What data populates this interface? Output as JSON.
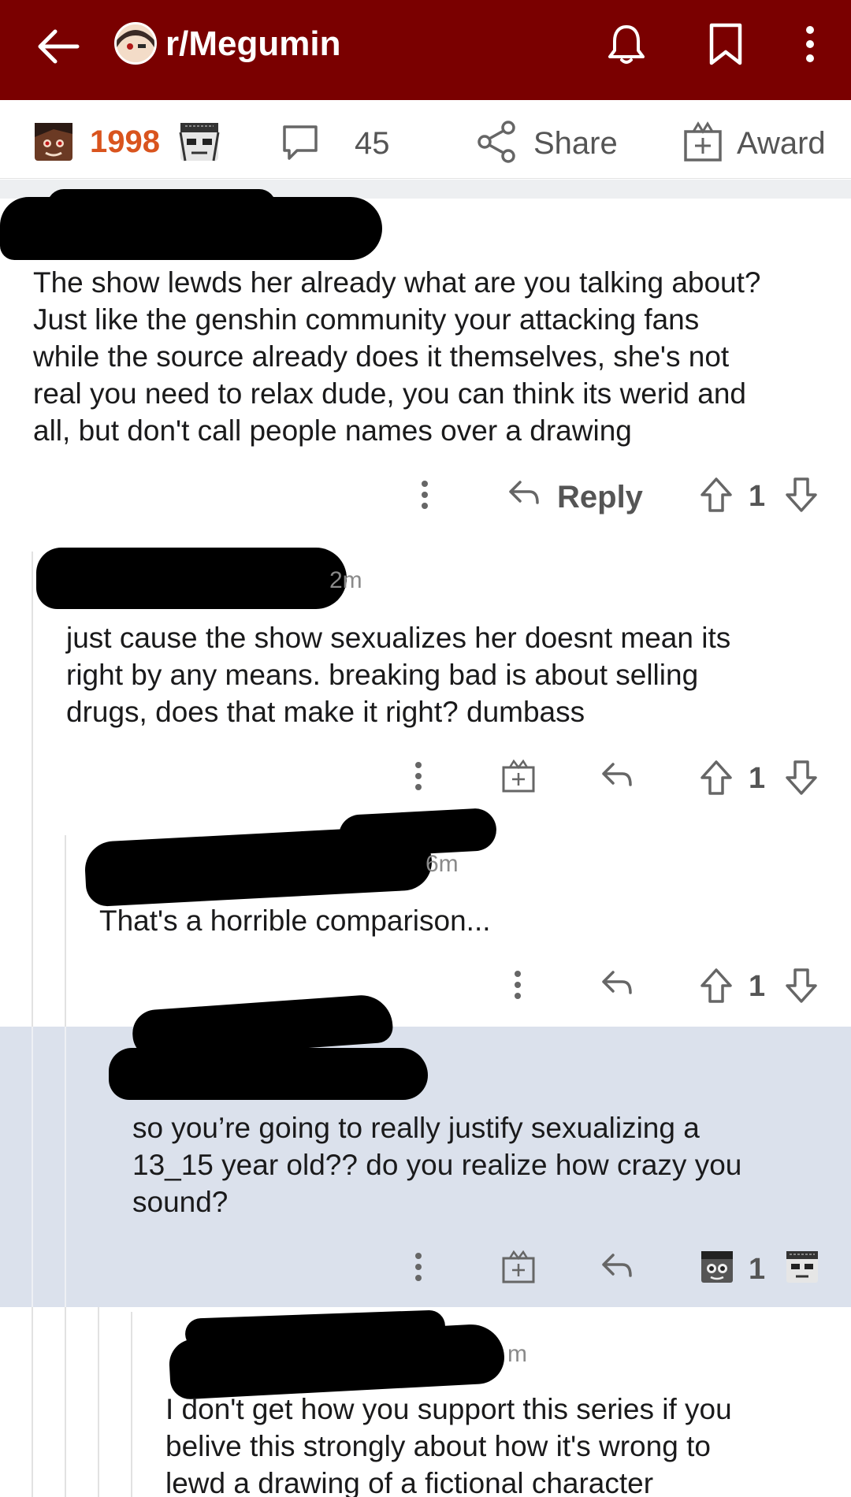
{
  "header": {
    "subreddit": "r/Megumin",
    "back_icon": "arrow-left-icon",
    "bell_icon": "bell-icon",
    "bookmark_icon": "bookmark-icon",
    "more_icon": "more-vertical-icon",
    "bar_color": "#7a0000"
  },
  "post_actions": {
    "score": "1998",
    "comment_count": "45",
    "share_label": "Share",
    "award_label": "Award",
    "score_color": "#d9541e"
  },
  "comments": [
    {
      "time": "",
      "text_lines": [
        "The show lewds her already what are you talking about?",
        "Just like the genshin community your attacking fans",
        "while the source already does it themselves, she's not",
        "real you need to relax dude, you can think its werid and",
        "all, but don't call people names over a drawing"
      ],
      "reply_label": "Reply",
      "votes": "1"
    },
    {
      "time": "2m",
      "text_lines": [
        "just cause the show sexualizes her doesnt mean its",
        "right by any means. breaking bad is about selling",
        "drugs, does that make it right? dumbass"
      ],
      "votes": "1"
    },
    {
      "time": "6m",
      "text_lines": [
        "That's a horrible comparison..."
      ],
      "votes": "1"
    },
    {
      "time": "",
      "text_lines": [
        "so you’re going to really justify sexualizing a",
        "13_15 year old?? do you realize how crazy you",
        "sound?"
      ],
      "votes": "1",
      "highlighted": true,
      "highlight_color": "#dbe1ec"
    },
    {
      "time": "m",
      "text_lines": [
        "I don't get how you support this series if you",
        "belive this strongly about how it's wrong to",
        "lewd a drawing of a fictional character"
      ]
    }
  ]
}
